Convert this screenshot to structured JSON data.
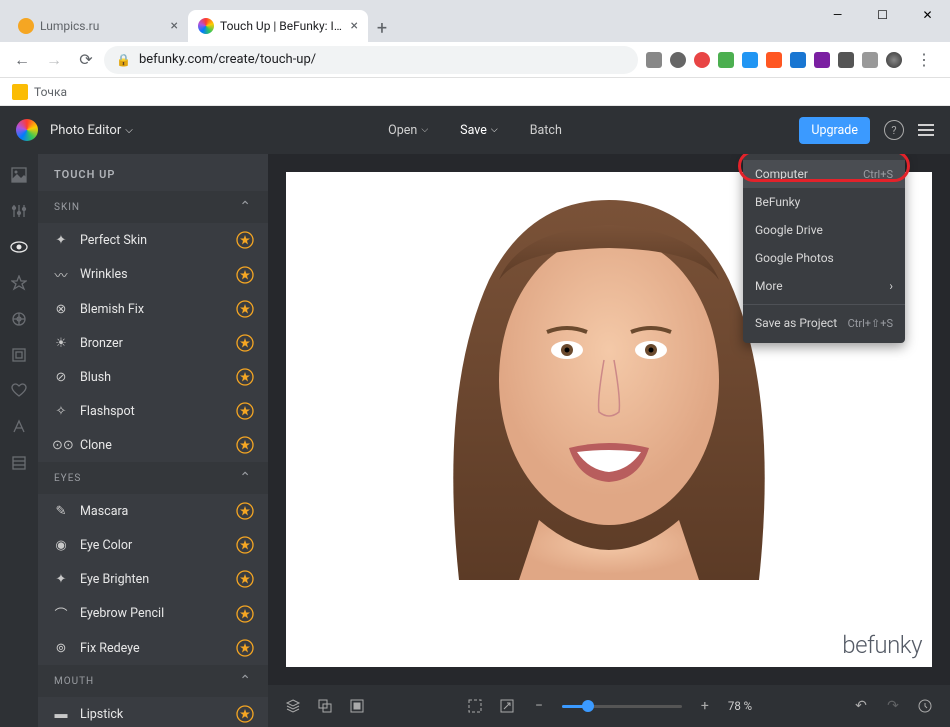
{
  "browser": {
    "tabs": [
      {
        "title": "Lumpics.ru",
        "favicon": "#f5a623",
        "active": false
      },
      {
        "title": "Touch Up | BeFunky: Image Reto...",
        "favicon": "conic",
        "active": true
      }
    ],
    "url": "befunky.com/create/touch-up/",
    "bookmark": "Точка"
  },
  "app": {
    "title": "Photo Editor",
    "menu": {
      "open": "Open",
      "save": "Save",
      "batch": "Batch"
    },
    "upgrade": "Upgrade"
  },
  "dropdown": {
    "items": [
      {
        "label": "Computer",
        "shortcut": "Ctrl+S",
        "highlighted": true
      },
      {
        "label": "BeFunky"
      },
      {
        "label": "Google Drive"
      },
      {
        "label": "Google Photos"
      },
      {
        "label": "More",
        "arrow": true
      },
      {
        "sep": true
      },
      {
        "label": "Save as Project",
        "shortcut": "Ctrl+⇧+S"
      }
    ]
  },
  "panel": {
    "title": "TOUCH UP",
    "sections": [
      {
        "head": "SKIN",
        "items": [
          {
            "icon": "✦",
            "label": "Perfect Skin"
          },
          {
            "icon": "〰",
            "label": "Wrinkles"
          },
          {
            "icon": "⊗",
            "label": "Blemish Fix"
          },
          {
            "icon": "☀",
            "label": "Bronzer"
          },
          {
            "icon": "⊘",
            "label": "Blush"
          },
          {
            "icon": "✧",
            "label": "Flashspot"
          },
          {
            "icon": "⊙⊙",
            "label": "Clone"
          }
        ]
      },
      {
        "head": "EYES",
        "items": [
          {
            "icon": "✎",
            "label": "Mascara"
          },
          {
            "icon": "◉",
            "label": "Eye Color"
          },
          {
            "icon": "✦",
            "label": "Eye Brighten"
          },
          {
            "icon": "⌒",
            "label": "Eyebrow Pencil"
          },
          {
            "icon": "⊚",
            "label": "Fix Redeye"
          }
        ]
      },
      {
        "head": "MOUTH",
        "items": [
          {
            "icon": "▬",
            "label": "Lipstick"
          }
        ]
      }
    ]
  },
  "watermark": "befunky",
  "zoom": "78 %"
}
